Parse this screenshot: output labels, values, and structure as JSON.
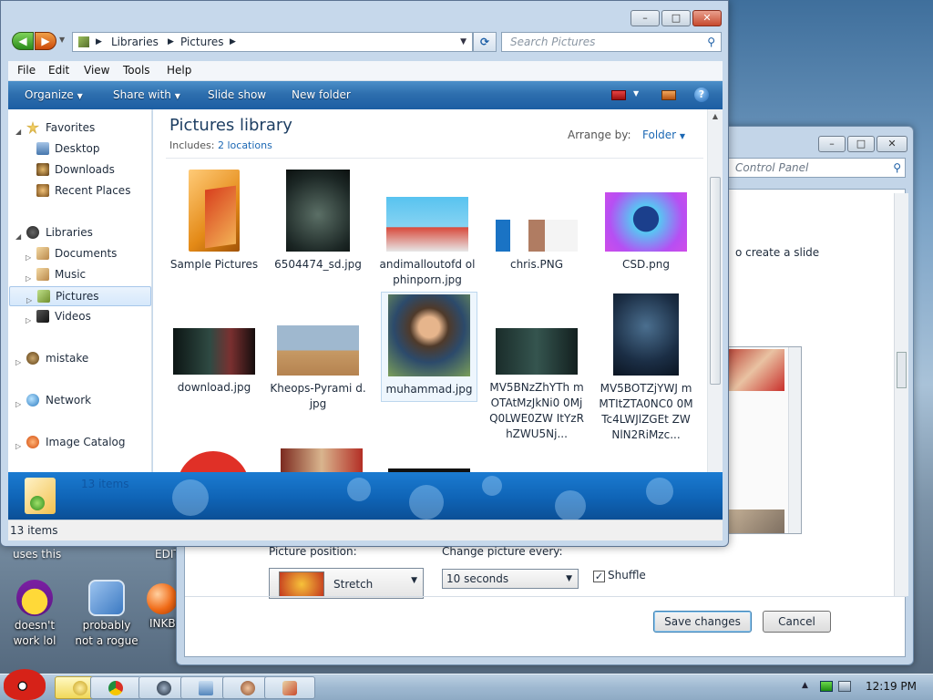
{
  "explorer": {
    "breadcrumb": [
      "Libraries",
      "Pictures"
    ],
    "search_placeholder": "Search Pictures",
    "menu": [
      "File",
      "Edit",
      "View",
      "Tools",
      "Help"
    ],
    "commands": [
      "Organize",
      "Share with",
      "Slide show",
      "New folder"
    ],
    "nav": {
      "favorites": "Favorites",
      "desktop": "Desktop",
      "downloads": "Downloads",
      "recent": "Recent Places",
      "libraries": "Libraries",
      "documents": "Documents",
      "music": "Music",
      "pictures": "Pictures",
      "videos": "Videos",
      "mistake": "mistake",
      "network": "Network",
      "image_catalog": "Image Catalog"
    },
    "library_title": "Pictures library",
    "includes_label": "Includes:",
    "includes_link": "2 locations",
    "arrange_label": "Arrange by:",
    "arrange_value": "Folder",
    "items": [
      {
        "name": "Sample Pictures"
      },
      {
        "name": "6504474_sd.jpg"
      },
      {
        "name": "andimalloutofd olphinporn.jpg"
      },
      {
        "name": "chris.PNG"
      },
      {
        "name": "CSD.png"
      },
      {
        "name": "download.jpg"
      },
      {
        "name": "Kheops-Pyrami d.jpg"
      },
      {
        "name": "muhammad.jpg"
      },
      {
        "name": "MV5BNzZhYTh mOTAtMzJkNi0 0MjQ0LWE0ZW ItYzRhZWU5Nj..."
      },
      {
        "name": "MV5BOTZjYWJ mMTItZTA0NC0 0MTc4LWJlZGEt ZWNlN2RiMzc..."
      }
    ],
    "details_count": "13 items",
    "status_count": "13 items"
  },
  "control_panel": {
    "search_placeholder": "Control Panel",
    "text_fragment": "o create a slide",
    "picture_position_label": "Picture position:",
    "picture_position_value": "Stretch",
    "change_every_label": "Change picture every:",
    "change_every_value": "10 seconds",
    "shuffle_label": "Shuffle",
    "shuffle_checked": true,
    "save_label": "Save changes",
    "cancel_label": "Cancel"
  },
  "desktop": {
    "frag_uses": "uses this",
    "frag_edition": "EDITIO",
    "icons": [
      {
        "label": "doesn't work lol"
      },
      {
        "label": "probably not a rogue"
      },
      {
        "label": "INKBA"
      }
    ]
  },
  "taskbar": {
    "time": "12:19 PM"
  },
  "colors": {
    "accent": "#1d5fa6",
    "link": "#1c68b4"
  }
}
